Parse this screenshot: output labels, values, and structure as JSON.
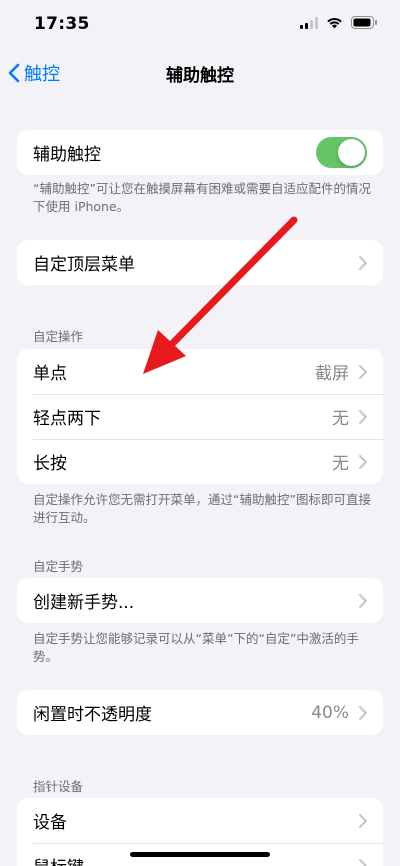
{
  "status": {
    "time": "17:35"
  },
  "nav": {
    "back_label": "触控",
    "title": "辅助触控"
  },
  "sections": {
    "assistive": {
      "label": "辅助触控",
      "toggle_on": true,
      "footer": "“辅助触控”可让您在触摸屏幕有困难或需要自适应配件的情况下使用 iPhone。"
    },
    "top_menu": {
      "label": "自定顶层菜单"
    },
    "custom_actions": {
      "header": "自定操作",
      "rows": [
        {
          "label": "单点",
          "value": "截屏"
        },
        {
          "label": "轻点两下",
          "value": "无"
        },
        {
          "label": "长按",
          "value": "无"
        }
      ],
      "footer": "自定操作允许您无需打开菜单，通过“辅助触控”图标即可直接进行互动。"
    },
    "custom_gestures": {
      "header": "自定手势",
      "row_label": "创建新手势...",
      "footer": "自定手势让您能够记录可以从“菜单”下的“自定”中激活的手势。"
    },
    "idle_opacity": {
      "label": "闲置时不透明度",
      "value": "40%"
    },
    "pointer_devices": {
      "header": "指针设备",
      "rows": [
        {
          "label": "设备"
        },
        {
          "label": "鼠标键"
        }
      ]
    }
  },
  "colors": {
    "accent": "#007aff",
    "toggle_on": "#65c466",
    "annotation_arrow": "#e8191c"
  }
}
